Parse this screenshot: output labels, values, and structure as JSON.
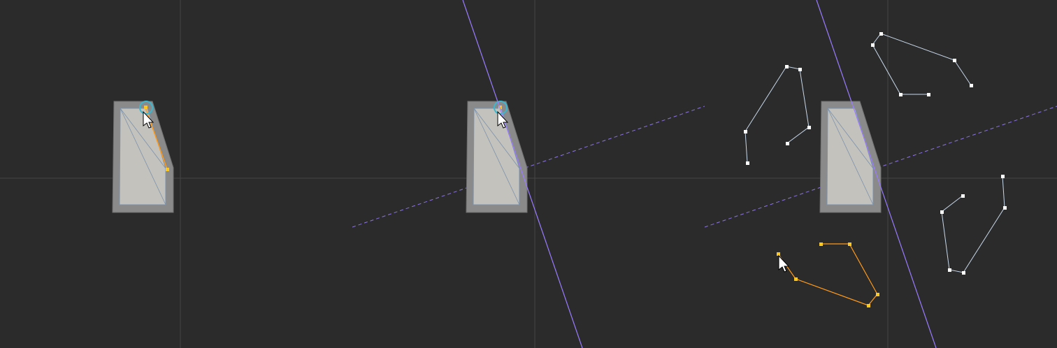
{
  "viewport": {
    "background": "#2b2b2b",
    "grid_color": "#454545",
    "mesh_outer_color": "#8a8a8a",
    "mesh_face_color": "#c4c2bc",
    "mesh_edge_color": "#7b92ad",
    "selected_color": "#ff9a1a",
    "selected_vertex_color": "#ffc81e",
    "highlight_ring_color": "#3bb8d0",
    "mirror_axis_color": "#9a7cff",
    "mirror_plane_color": "#8c74e6",
    "unselected_curve_color": "#c7d8ea",
    "cursor": "arrow-cursor-icon"
  },
  "panels": [
    {
      "name": "step-1-vertex-selected",
      "has_mirror_axis": false,
      "curves": []
    },
    {
      "name": "step-2-mirror-axis-shown",
      "has_mirror_axis": true,
      "curves": []
    },
    {
      "name": "step-3-curves-mirrored",
      "has_mirror_axis": true,
      "curves": [
        "curve-upper-left",
        "curve-upper-right",
        "curve-lower-right",
        "curve-lower-left-selected"
      ]
    }
  ]
}
